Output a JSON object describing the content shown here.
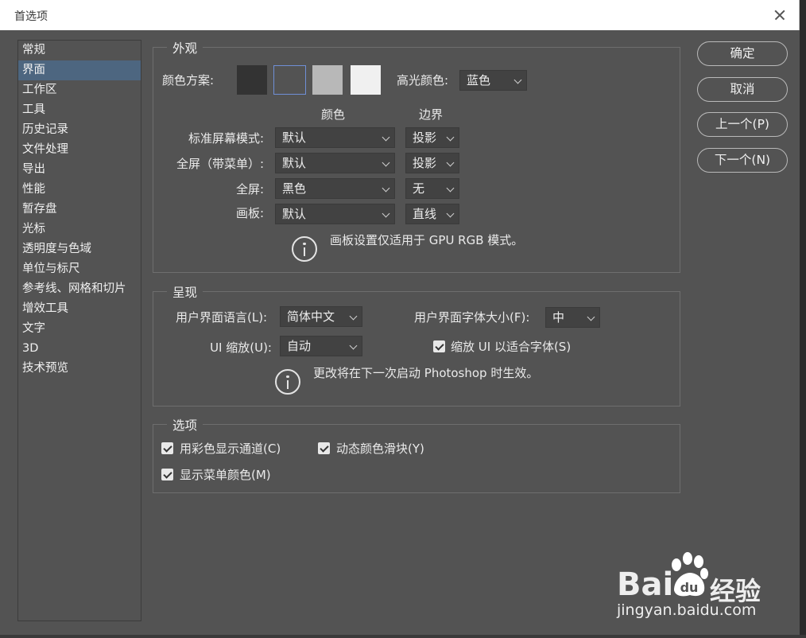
{
  "window": {
    "title": "首选项"
  },
  "sidebar": {
    "items": [
      {
        "label": "常规"
      },
      {
        "label": "界面"
      },
      {
        "label": "工作区"
      },
      {
        "label": "工具"
      },
      {
        "label": "历史记录"
      },
      {
        "label": "文件处理"
      },
      {
        "label": "导出"
      },
      {
        "label": "性能"
      },
      {
        "label": "暂存盘"
      },
      {
        "label": "光标"
      },
      {
        "label": "透明度与色域"
      },
      {
        "label": "单位与标尺"
      },
      {
        "label": "参考线、网格和切片"
      },
      {
        "label": "增效工具"
      },
      {
        "label": "文字"
      },
      {
        "label": "3D"
      },
      {
        "label": "技术预览"
      }
    ],
    "selected": "界面"
  },
  "appearance": {
    "legend": "外观",
    "color_scheme_label": "颜色方案:",
    "swatches": [
      "#333333",
      "#535353",
      "#b8b8b8",
      "#f0f0f0"
    ],
    "selected_swatch": 2,
    "highlight_label": "高光颜色:",
    "highlight_value": "蓝色",
    "col_color": "颜色",
    "col_border": "边界",
    "rows": [
      {
        "label": "标准屏幕模式:",
        "color": "默认",
        "border": "投影"
      },
      {
        "label": "全屏（带菜单）:",
        "color": "默认",
        "border": "投影"
      },
      {
        "label": "全屏:",
        "color": "黑色",
        "border": "无"
      },
      {
        "label": "画板:",
        "color": "默认",
        "border": "直线"
      }
    ],
    "note": "画板设置仅适用于 GPU RGB 模式。"
  },
  "presentation": {
    "legend": "呈现",
    "lang_label": "用户界面语言(L):",
    "lang_value": "简体中文",
    "font_size_label": "用户界面字体大小(F):",
    "font_size_value": "中",
    "scale_label": "UI 缩放(U):",
    "scale_value": "自动",
    "scale_fit_label": "缩放 UI 以适合字体(S)",
    "scale_fit_checked": true,
    "note": "更改将在下一次启动 Photoshop 时生效。"
  },
  "options": {
    "legend": "选项",
    "checkboxes": [
      {
        "label": "用彩色显示通道(C)",
        "checked": true
      },
      {
        "label": "动态颜色滑块(Y)",
        "checked": true
      },
      {
        "label": "显示菜单颜色(M)",
        "checked": true
      }
    ]
  },
  "buttons": {
    "ok": "确定",
    "cancel": "取消",
    "prev": "上一个(P)",
    "next": "下一个(N)"
  },
  "watermark": {
    "brand": "Bai",
    "brand2": "经验",
    "url": "jingyan.baidu.com"
  }
}
